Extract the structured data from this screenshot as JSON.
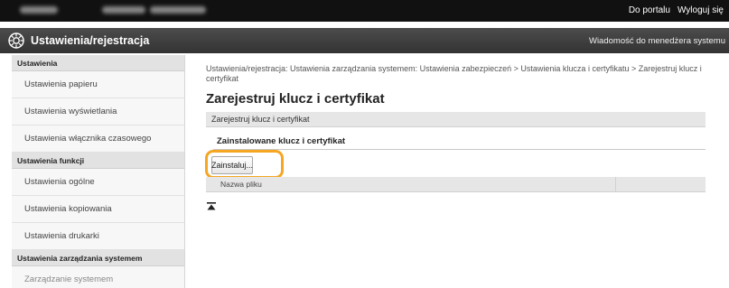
{
  "topbar": {
    "portal_link": "Do portalu",
    "logout_link": "Wyloguj się"
  },
  "header": {
    "title": "Ustawienia/rejestracja",
    "manager_message": "Wiadomość do menedżera systemu"
  },
  "sidebar": {
    "sections": [
      {
        "title": "Ustawienia",
        "items": [
          "Ustawienia papieru",
          "Ustawienia wyświetlania",
          "Ustawienia włącznika czasowego"
        ]
      },
      {
        "title": "Ustawienia funkcji",
        "items": [
          "Ustawienia ogólne",
          "Ustawienia kopiowania",
          "Ustawienia drukarki"
        ]
      },
      {
        "title": "Ustawienia zarządzania systemem",
        "items": [
          "Zarządzanie systemem"
        ]
      }
    ]
  },
  "main": {
    "breadcrumb": "Ustawienia/rejestracja: Ustawienia zarządzania systemem: Ustawienia zabezpieczeń > Ustawienia klucza i certyfikatu > Zarejestruj klucz i certyfikat",
    "page_title": "Zarejestruj klucz i certyfikat",
    "section_title": "Zarejestruj klucz i certyfikat",
    "sub_title": "Zainstalowane klucz i certyfikat",
    "install_button": "Zainstaluj...",
    "table_column": "Nazwa pliku"
  },
  "colors": {
    "highlight": "#f5a623",
    "topbar": "#111111",
    "titlebar": "#3d3d3d"
  }
}
